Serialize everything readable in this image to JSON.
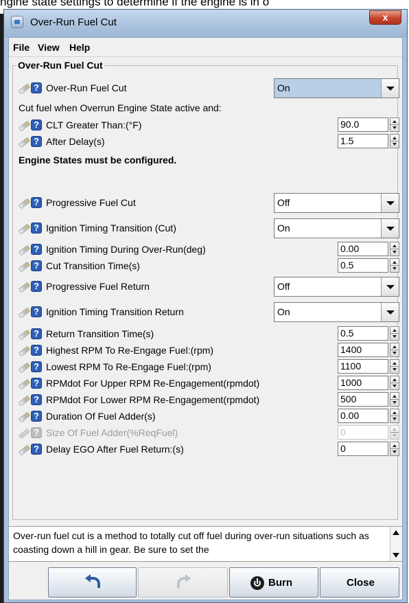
{
  "background_caption": "ngine state settings to determine if the engine is in o",
  "window": {
    "title": "Over-Run Fuel Cut",
    "close_glyph": "x"
  },
  "menu": [
    {
      "label": "File"
    },
    {
      "label": "View"
    },
    {
      "label": "Help"
    }
  ],
  "group_title": "Over-Run Fuel Cut",
  "fields": {
    "overrun_fuel_cut": {
      "label": "Over-Run Fuel Cut",
      "value": "On"
    },
    "cut_fuel_note": "Cut fuel when Overrun Engine State active and:",
    "clt_greater_than": {
      "label": "CLT Greater Than:(°F)",
      "value": "90.0"
    },
    "after_delay": {
      "label": "After Delay(s)",
      "value": "1.5"
    },
    "engine_states_note": "Engine States must be configured.",
    "progressive_fuel_cut": {
      "label": "Progressive Fuel Cut",
      "value": "Off"
    },
    "ignition_timing_transition_cut": {
      "label": "Ignition Timing Transition (Cut)",
      "value": "On"
    },
    "ignition_timing_during_overrun": {
      "label": "Ignition Timing During Over-Run(deg)",
      "value": "0.00"
    },
    "cut_transition_time": {
      "label": "Cut Transition Time(s)",
      "value": "0.5"
    },
    "progressive_fuel_return": {
      "label": "Progressive Fuel Return",
      "value": "Off"
    },
    "ignition_timing_transition_return": {
      "label": "Ignition Timing Transition Return",
      "value": "On"
    },
    "return_transition_time": {
      "label": "Return Transition Time(s)",
      "value": "0.5"
    },
    "highest_rpm_reengage": {
      "label": "Highest RPM To Re-Engage Fuel:(rpm)",
      "value": "1400"
    },
    "lowest_rpm_reengage": {
      "label": "Lowest RPM To Re-Engage Fuel:(rpm)",
      "value": "1100"
    },
    "rpmdot_upper": {
      "label": "RPMdot For Upper RPM Re-Engagement(rpmdot)",
      "value": "1000"
    },
    "rpmdot_lower": {
      "label": "RPMdot For Lower RPM Re-Engagement(rpmdot)",
      "value": "500"
    },
    "duration_fuel_adder": {
      "label": "Duration Of Fuel Adder(s)",
      "value": "0.00"
    },
    "size_fuel_adder": {
      "label": "Size Of Fuel Adder(%ReqFuel)",
      "value": "0"
    },
    "delay_ego": {
      "label": "Delay EGO After Fuel Return:(s)",
      "value": "0"
    }
  },
  "description": "Over-run fuel cut is a method to totally cut off fuel during over-run situations such as coasting down a hill in gear. Be sure to set the",
  "buttons": {
    "burn": "Burn",
    "close": "Close"
  },
  "colors": {
    "title_bar": "#a9c2dd",
    "selected_combo": "#b8cfe5",
    "help_icon": "#2f5fb6",
    "close_button": "#c7432a"
  }
}
